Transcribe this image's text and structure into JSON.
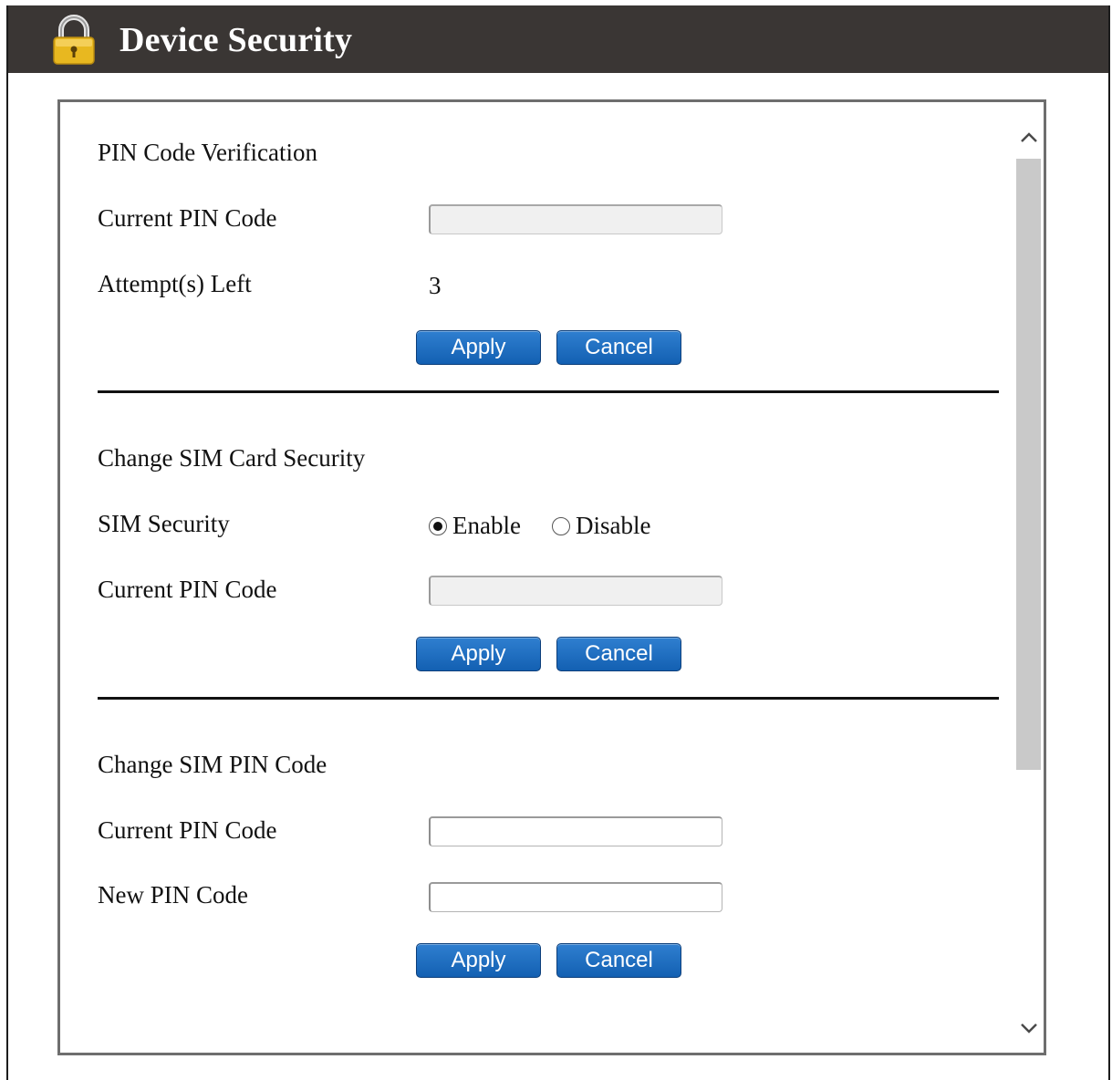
{
  "window": {
    "title": "Device Security"
  },
  "sections": [
    {
      "title": "PIN Code Verification",
      "fields": [
        {
          "label": "Current PIN Code",
          "value": ""
        },
        {
          "label": "Attempt(s) Left",
          "value": "3"
        }
      ],
      "apply_label": "Apply",
      "cancel_label": "Cancel"
    },
    {
      "title": "Change SIM Card Security",
      "fields": [
        {
          "label": "SIM Security",
          "options": [
            "Enable",
            "Disable"
          ],
          "selected": "Enable"
        },
        {
          "label": "Current PIN Code",
          "value": ""
        }
      ],
      "apply_label": "Apply",
      "cancel_label": "Cancel"
    },
    {
      "title": "Change SIM PIN Code",
      "fields": [
        {
          "label": "Current PIN Code",
          "value": ""
        },
        {
          "label": "New PIN Code",
          "value": ""
        }
      ],
      "apply_label": "Apply",
      "cancel_label": "Cancel"
    }
  ],
  "icons": {
    "title": "lock-icon",
    "scroll_up": "chevron-up-icon",
    "scroll_down": "chevron-down-icon"
  },
  "colors": {
    "title_bar": "#3a3634",
    "button": "#1b6cc0",
    "lock": "#e8b820"
  }
}
